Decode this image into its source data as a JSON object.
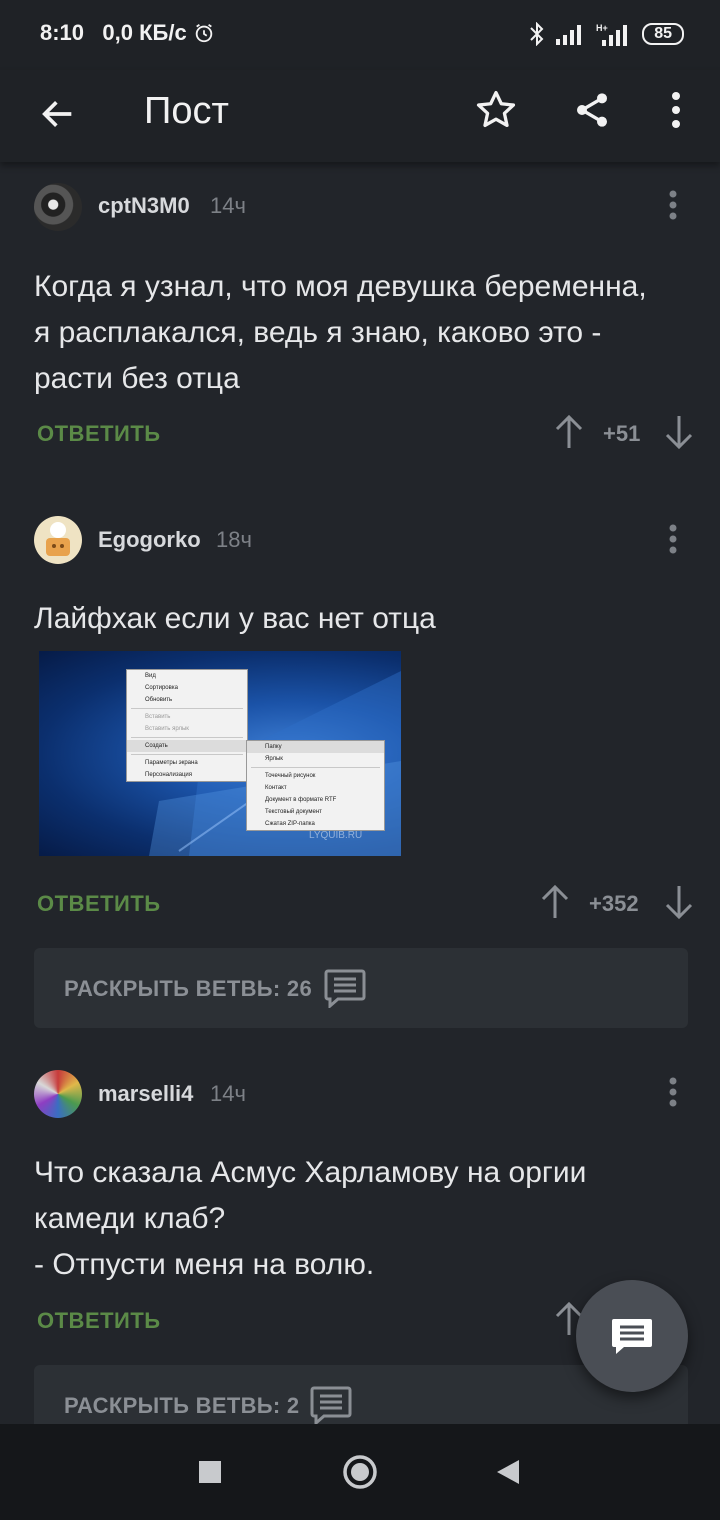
{
  "status_bar": {
    "time": "8:10",
    "speed": "0,0 КБ/с",
    "battery": "85"
  },
  "app_bar": {
    "title": "Пост"
  },
  "comments": [
    {
      "user": "cptN3M0",
      "time": "14ч",
      "text_lines": [
        "Когда я узнал, что моя девушка беременна,",
        "я расплакался, ведь я знаю, каково это -",
        "расти без отца"
      ],
      "reply": "ОТВЕТИТЬ",
      "score": "+51"
    },
    {
      "user": "Egogorko",
      "time": "18ч",
      "text_lines": [
        "Лайфхак если у вас нет отца"
      ],
      "reply": "ОТВЕТИТЬ",
      "score": "+352",
      "expand": "РАСКРЫТЬ ВЕТВЬ: 26",
      "image": {
        "menu_items": [
          "Вид",
          "Сортировка",
          "Обновить",
          "Вставить",
          "Вставить ярлык",
          "Создать",
          "Параметры экрана",
          "Персонализация"
        ],
        "submenu_items": [
          "Папку",
          "Ярлык",
          "Точечный рисунок",
          "Контакт",
          "Документ в формате RTF",
          "Текстовый документ",
          "Сжатая ZIP-папка"
        ],
        "watermark": "LYQUIB.RU"
      }
    },
    {
      "user": "marselli4",
      "time": "14ч",
      "text_lines": [
        "Что сказала Асмус Харламову на оргии",
        "камеди клаб?",
        "- Отпусти меня на волю."
      ],
      "reply": "ОТВЕТИТЬ",
      "expand": "РАСКРЫТЬ ВЕТВЬ: 2"
    }
  ],
  "icons": {
    "back": "arrow-left-icon",
    "favorite": "star-icon",
    "share": "share-icon",
    "overflow": "more-vert-icon",
    "upvote": "arrow-up-icon",
    "downvote": "arrow-down-icon",
    "comments": "comment-icon"
  },
  "colors": {
    "background": "#22252a",
    "appbar": "#1f2226",
    "reply_green": "#5b8a47",
    "muted": "#8b8f95"
  }
}
